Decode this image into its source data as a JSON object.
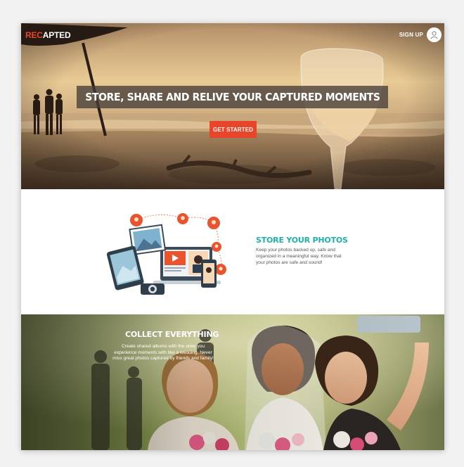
{
  "brand": {
    "logo_accent": "REC",
    "logo_rest": "APTED",
    "accent_color": "#e8432b"
  },
  "header": {
    "signup_label": "SIGN UP",
    "avatar_icon": "user-icon"
  },
  "hero": {
    "headline": "STORE, SHARE AND RELIVE YOUR CAPTURED MOMENTS",
    "cta_label": "GET STARTED",
    "cta_color": "#e9452a"
  },
  "feature": {
    "title": "STORE YOUR PHOTOS",
    "text": "Keep your photos backed up, safe and organized in a meaningful way. Know that your photos are safe and sound!",
    "title_color": "#1fb2a8"
  },
  "collect": {
    "title": "COLLECT EVERYTHING",
    "text": "Create shared albums with the ones you experience moments with like a wedding. Never miss great photos captured by friends and family!"
  }
}
